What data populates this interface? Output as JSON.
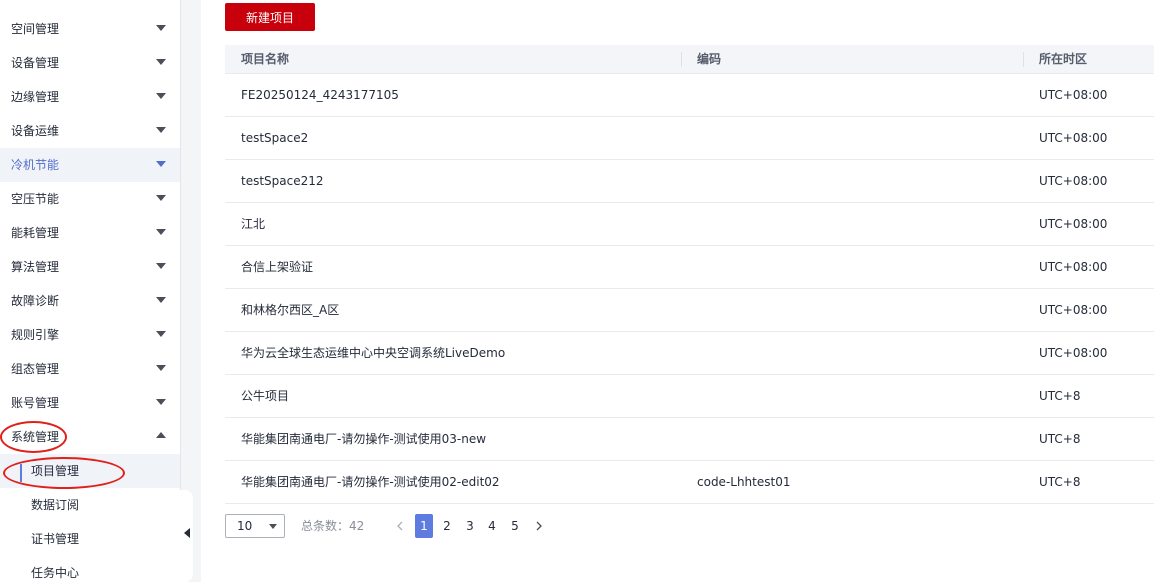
{
  "sidebar": {
    "menu": [
      {
        "label": "空间管理"
      },
      {
        "label": "设备管理"
      },
      {
        "label": "边缘管理"
      },
      {
        "label": "设备运维"
      },
      {
        "label": "冷机节能"
      },
      {
        "label": "空压节能"
      },
      {
        "label": "能耗管理"
      },
      {
        "label": "算法管理"
      },
      {
        "label": "故障诊断"
      },
      {
        "label": "规则引擎"
      },
      {
        "label": "组态管理"
      },
      {
        "label": "账号管理"
      },
      {
        "label": "系统管理"
      }
    ],
    "submenu": [
      {
        "label": "项目管理"
      },
      {
        "label": "数据订阅"
      },
      {
        "label": "证书管理"
      },
      {
        "label": "任务中心"
      }
    ]
  },
  "toolbar": {
    "new_project_label": "新建项目"
  },
  "table": {
    "columns": [
      "项目名称",
      "编码",
      "所在时区"
    ],
    "rows": [
      {
        "name": "FE20250124_4243177105",
        "code": "",
        "timezone": "UTC+08:00"
      },
      {
        "name": "testSpace2",
        "code": "",
        "timezone": "UTC+08:00"
      },
      {
        "name": "testSpace212",
        "code": "",
        "timezone": "UTC+08:00"
      },
      {
        "name": "江北",
        "code": "",
        "timezone": "UTC+08:00"
      },
      {
        "name": "合信上架验证",
        "code": "",
        "timezone": "UTC+08:00"
      },
      {
        "name": "和林格尔西区_A区",
        "code": "",
        "timezone": "UTC+08:00"
      },
      {
        "name": "华为云全球生态运维中心中央空调系统LiveDemo",
        "code": "",
        "timezone": "UTC+08:00"
      },
      {
        "name": "公牛项目",
        "code": "",
        "timezone": "UTC+8"
      },
      {
        "name": "华能集团南通电厂-请勿操作-测试使用03-new",
        "code": "",
        "timezone": "UTC+8"
      },
      {
        "name": "华能集团南通电厂-请勿操作-测试使用02-edit02",
        "code": "code-Lhhtest01",
        "timezone": "UTC+8"
      }
    ]
  },
  "pagination": {
    "page_size": "10",
    "total_label": "总条数：42",
    "pages": [
      "1",
      "2",
      "3",
      "4",
      "5"
    ],
    "current_page": "1"
  },
  "colors": {
    "primary_button": "#c7000b",
    "accent": "#5e7ce0",
    "annotation": "#e0201b"
  }
}
